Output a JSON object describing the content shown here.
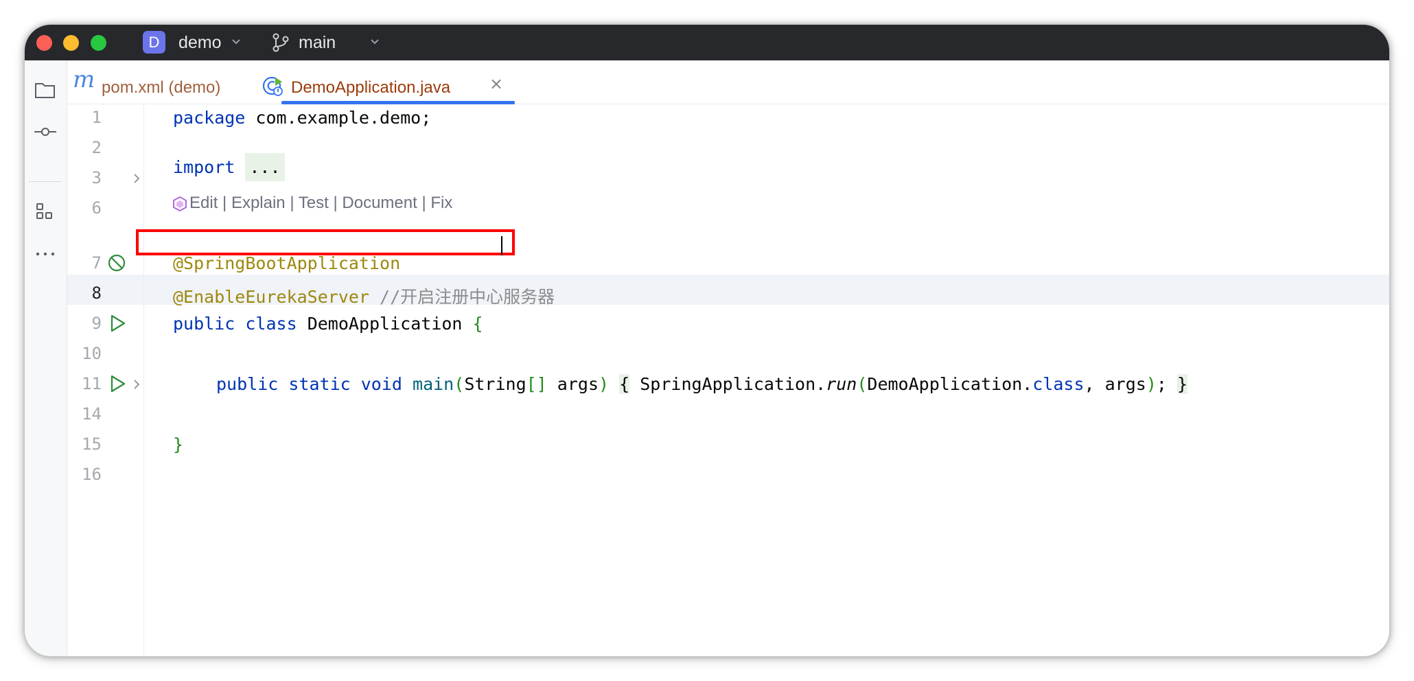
{
  "window": {
    "project_badge": "D",
    "project_name": "demo",
    "branch_name": "main"
  },
  "toolstrip": {
    "icons": [
      "project-folder-icon",
      "commit-icon",
      "structure-icon",
      "more-icon"
    ]
  },
  "tabs": [
    {
      "icon": "m",
      "label": "pom.xml (demo)",
      "active": false
    },
    {
      "label": "DemoApplication.java",
      "close": "×",
      "active": true
    }
  ],
  "editor": {
    "line_numbers": [
      "1",
      "2",
      "3",
      "6",
      "7",
      "8",
      "9",
      "10",
      "11",
      "14",
      "15",
      "16"
    ],
    "inlay": {
      "items": [
        "Edit",
        "Explain",
        "Test",
        "Document",
        "Fix"
      ],
      "separator": "|"
    },
    "code": {
      "l1_kw": "package",
      "l1_rest": " com.example.demo;",
      "l3_kw": "import",
      "l3_fold": "...",
      "l7_ann": "@SpringBootApplication",
      "l8_ann": "@EnableEurekaServer",
      "l8_comment": "//开启注册中心服务器",
      "l9_kw1": "public",
      "l9_kw2": "class",
      "l9_name": "DemoApplication",
      "l9_brace": "{",
      "l11_kw1": "public",
      "l11_kw2": "static",
      "l11_kw3": "void",
      "l11_method": "main",
      "l11_paren_open": "(",
      "l11_type": "String",
      "l11_arr": "[]",
      "l11_args": " args",
      "l11_paren_close": ")",
      "l11_open": "{",
      "l11_call": "SpringApplication.",
      "l11_run": "run",
      "l11_paren2_open": "(",
      "l11_cls": "DemoApplication.",
      "l11_class_kw": "class",
      "l11_args2": ", args",
      "l11_paren2_close": ")",
      "l11_semi": ";",
      "l11_close": "}",
      "l15_brace": "}"
    }
  },
  "colors": {
    "keyword": "#0033b3",
    "annotation": "#9e880d",
    "comment": "#8c8c8c",
    "highlight_box": "#ff0000",
    "active_tab_underline": "#3574f0"
  }
}
